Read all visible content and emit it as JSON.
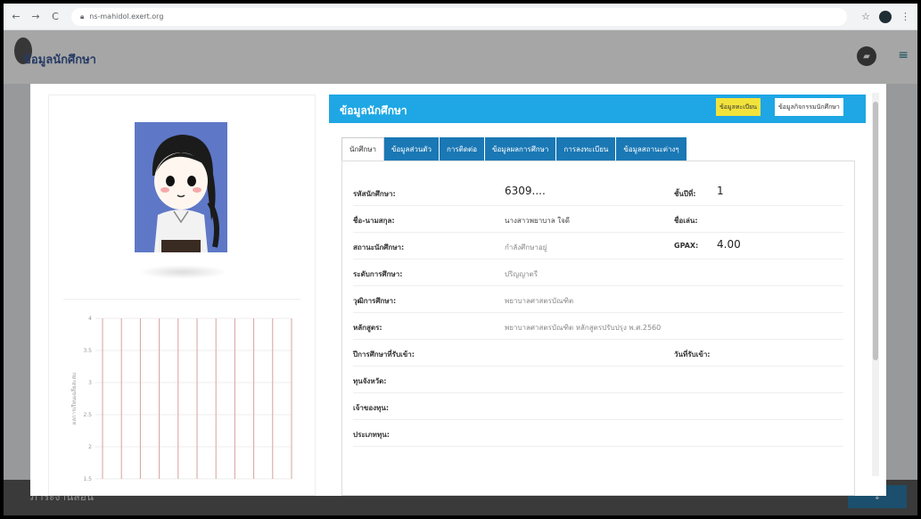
{
  "browser": {
    "url": "ns-mahidol.exert.org"
  },
  "app": {
    "title": "ข้อมูลนักศึกษา",
    "bottom_text": "ภาระงานสอน"
  },
  "student_panel": {
    "title": "ข้อมูลนักศึกษา",
    "header_buttons": [
      "ข้อมูลทะเบียน",
      "ข้อมูลกิจกรรมนักศึกษา"
    ],
    "tabs": [
      "นักศึกษา",
      "ข้อมูลส่วนตัว",
      "การติดต่อ",
      "ข้อมูลผลการศึกษา",
      "การลงทะเบียน",
      "ข้อมูลสถานะต่างๆ"
    ],
    "fields": [
      {
        "label": "รหัสนักศึกษา:",
        "value": "6309....",
        "label2": "ชั้นปีที่:",
        "value2": "1"
      },
      {
        "label": "ชื่อ-นามสกุล:",
        "value": "นางสาวพยาบาล ใจดี",
        "label2": "ชื่อเล่น:",
        "value2": ""
      },
      {
        "label": "สถานะนักศึกษา:",
        "value": "กำลังศึกษาอยู่",
        "label2": "GPAX:",
        "value2": "4.00"
      },
      {
        "label": "ระดับการศึกษา:",
        "value": "ปริญญาตรี",
        "label2": "",
        "value2": ""
      },
      {
        "label": "วุฒิการศึกษา:",
        "value": "พยาบาลศาสตรบัณฑิต",
        "label2": "",
        "value2": ""
      },
      {
        "label": "หลักสูตร:",
        "value": "พยาบาลศาสตรบัณฑิต หลักสูตรปรับปรุง พ.ศ.2560",
        "label2": "",
        "value2": ""
      },
      {
        "label": "ปีการศึกษาที่รับเข้า:",
        "value": "",
        "label2": "วันที่รับเข้า:",
        "value2": ""
      },
      {
        "label": "ทุนจังหวัด:",
        "value": "",
        "label2": "",
        "value2": ""
      },
      {
        "label": "เจ้าของทุน:",
        "value": "",
        "label2": "",
        "value2": ""
      },
      {
        "label": "ประเภททุน:",
        "value": "",
        "label2": "",
        "value2": ""
      }
    ]
  },
  "chart_data": {
    "type": "line",
    "ylabel": "ผลการเรียนเฉลี่ยสะสม",
    "ylim": [
      1.5,
      4
    ],
    "y_ticks": [
      "4",
      "3.5",
      "3",
      "2.5",
      "2",
      "1.5"
    ],
    "x": [],
    "series": []
  },
  "colors": {
    "header_blue": "#1ea7e4",
    "tab_blue": "#1a78b5",
    "highlight_yellow": "#f2e33c",
    "avatar_bg": "#5e78c7",
    "grid_line": "#d9a0a0"
  },
  "icons": {
    "back": "arrow-left-icon",
    "forward": "arrow-right-icon",
    "reload": "reload-icon",
    "lock": "lock-icon",
    "bookmark": "star-icon",
    "menu": "dots-vertical-icon",
    "header_action": "folder-icon",
    "hamburger": "hamburger-icon"
  }
}
